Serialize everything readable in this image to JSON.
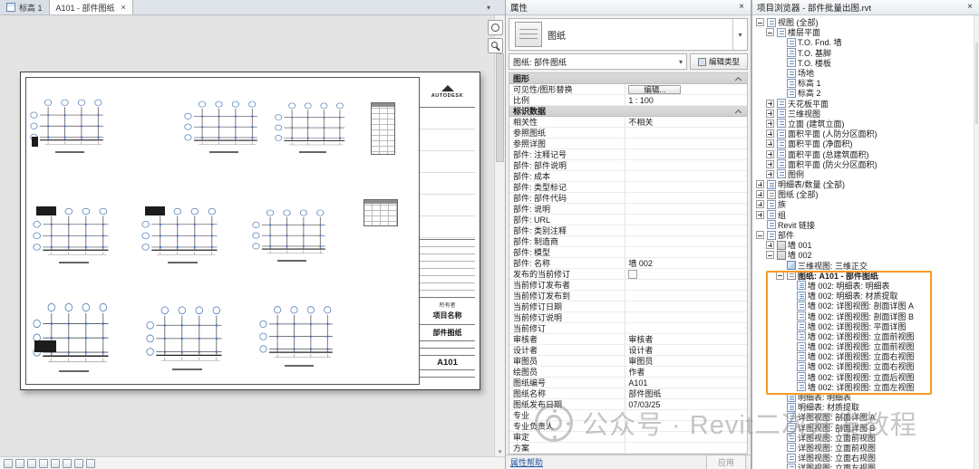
{
  "colors": {
    "highlight_orange": "#F59B22",
    "grid_bubble_blue": "#5D86C0",
    "selection_dot_blue": "#3F7BD9",
    "link_blue": "#1F55A5"
  },
  "icons": {
    "close": "×",
    "dropdown": "▾",
    "chevron_down": "▾",
    "scroll_up": "▴",
    "scroll_down": "▾"
  },
  "tabs": {
    "t1": {
      "label": "标高 1"
    },
    "t2": {
      "label": "A101 - 部件图纸"
    }
  },
  "sheet": {
    "logo": "AUTODESK",
    "owner": "所有者",
    "project": "项目名称",
    "title": "部件图纸",
    "number": "A101"
  },
  "properties": {
    "title": "属性",
    "type_label": "图纸",
    "instance_combo": "图纸: 部件图纸",
    "edit_type": "编辑类型",
    "help": "属性帮助",
    "apply": "应用",
    "rows": [
      {
        "cls": "hdr",
        "label": "图形",
        "value": ""
      },
      {
        "cls": "vbtn",
        "label": "可见性/图形替换",
        "value": "编辑..."
      },
      {
        "cls": "",
        "label": "比例",
        "value": "1 : 100"
      },
      {
        "cls": "hdr",
        "label": "标识数据",
        "value": ""
      },
      {
        "cls": "",
        "label": "相关性",
        "value": "不相关"
      },
      {
        "cls": "",
        "label": "参照图纸",
        "value": ""
      },
      {
        "cls": "",
        "label": "参照详图",
        "value": ""
      },
      {
        "cls": "",
        "label": "部件: 注释记号",
        "value": ""
      },
      {
        "cls": "",
        "label": "部件: 部件说明",
        "value": ""
      },
      {
        "cls": "",
        "label": "部件: 成本",
        "value": ""
      },
      {
        "cls": "",
        "label": "部件: 类型标记",
        "value": ""
      },
      {
        "cls": "",
        "label": "部件: 部件代码",
        "value": ""
      },
      {
        "cls": "",
        "label": "部件: 说明",
        "value": ""
      },
      {
        "cls": "",
        "label": "部件: URL",
        "value": ""
      },
      {
        "cls": "",
        "label": "部件: 类别注释",
        "value": ""
      },
      {
        "cls": "",
        "label": "部件: 制造商",
        "value": ""
      },
      {
        "cls": "",
        "label": "部件: 模型",
        "value": ""
      },
      {
        "cls": "",
        "label": "部件: 名称",
        "value": "墙 002"
      },
      {
        "cls": "vchk",
        "label": "发布的当前修订",
        "value": ""
      },
      {
        "cls": "",
        "label": "当前修订发布者",
        "value": ""
      },
      {
        "cls": "",
        "label": "当前修订发布到",
        "value": ""
      },
      {
        "cls": "",
        "label": "当前修订日期",
        "value": ""
      },
      {
        "cls": "",
        "label": "当前修订说明",
        "value": ""
      },
      {
        "cls": "",
        "label": "当前修订",
        "value": ""
      },
      {
        "cls": "",
        "label": "审核者",
        "value": "审核者"
      },
      {
        "cls": "",
        "label": "设计者",
        "value": "设计者"
      },
      {
        "cls": "",
        "label": "审图员",
        "value": "审图员"
      },
      {
        "cls": "",
        "label": "绘图员",
        "value": "作者"
      },
      {
        "cls": "",
        "label": "图纸编号",
        "value": "A101"
      },
      {
        "cls": "",
        "label": "图纸名称",
        "value": "部件图纸"
      },
      {
        "cls": "",
        "label": "图纸发布日期",
        "value": "07/03/25"
      },
      {
        "cls": "",
        "label": "专业",
        "value": ""
      },
      {
        "cls": "",
        "label": "专业负责人",
        "value": ""
      },
      {
        "cls": "",
        "label": "审定",
        "value": ""
      },
      {
        "cls": "",
        "label": "方案",
        "value": ""
      }
    ]
  },
  "browser": {
    "title": "项目浏览器 - 部件批量出图.rvt",
    "nodes_before": [
      {
        "label": "视图 (全部)",
        "cls": "lvl0 minus ic-views"
      },
      {
        "label": "楼层平面",
        "cls": "lvl1 minus ic-cat"
      },
      {
        "label": "T.O. Fnd. 墙",
        "cls": "lvl2 none ic-plan"
      },
      {
        "label": "T.O. 基脚",
        "cls": "lvl2 none ic-plan"
      },
      {
        "label": "T.O. 楼板",
        "cls": "lvl2 none ic-plan"
      },
      {
        "label": "场地",
        "cls": "lvl2 none ic-plan"
      },
      {
        "label": "标高 1",
        "cls": "lvl2 none ic-plan"
      },
      {
        "label": "标高 2",
        "cls": "lvl2 none ic-plan"
      },
      {
        "label": "天花板平面",
        "cls": "lvl1 plus ic-cat"
      },
      {
        "label": "三维视图",
        "cls": "lvl1 plus ic-cat"
      },
      {
        "label": "立面 (建筑立面)",
        "cls": "lvl1 plus ic-cat"
      },
      {
        "label": "面积平面 (人防分区面积)",
        "cls": "lvl1 plus ic-cat"
      },
      {
        "label": "面积平面 (净面积)",
        "cls": "lvl1 plus ic-cat"
      },
      {
        "label": "面积平面 (总建筑面积)",
        "cls": "lvl1 plus ic-cat"
      },
      {
        "label": "面积平面 (防火分区面积)",
        "cls": "lvl1 plus ic-cat"
      },
      {
        "label": "图例",
        "cls": "lvl1 plus ic-cat"
      },
      {
        "label": "明细表/数量 (全部)",
        "cls": "lvl0 plus ic-schedule"
      },
      {
        "label": "图纸 (全部)",
        "cls": "lvl0 plus ic-sheet"
      },
      {
        "label": "族",
        "cls": "lvl0 plus ic-family"
      },
      {
        "label": "组",
        "cls": "lvl0 plus ic-group"
      },
      {
        "label": "Revit 链接",
        "cls": "lvl0 none ic-link"
      },
      {
        "label": "部件",
        "cls": "lvl0 minus ic-assembly"
      },
      {
        "label": "墙 001",
        "cls": "lvl1 plus ic-wall"
      },
      {
        "label": "墙 002",
        "cls": "lvl1 minus ic-wall"
      },
      {
        "label": "三维视图: 三维正交",
        "cls": "lvl2 none ic-3d"
      }
    ],
    "highlight_nodes": [
      {
        "label": "图纸: A101 - 部件图纸",
        "cls": "lvl2 minus ic-sheet bold"
      },
      {
        "label": "墙 002: 明细表: 明细表",
        "cls": "lvl3 none ic-schedule"
      },
      {
        "label": "墙 002: 明细表: 材质提取",
        "cls": "lvl3 none ic-schedule"
      },
      {
        "label": "墙 002: 详图视图: 剖面详图 A",
        "cls": "lvl3 none ic-view"
      },
      {
        "label": "墙 002: 详图视图: 剖面详图 B",
        "cls": "lvl3 none ic-view"
      },
      {
        "label": "墙 002: 详图视图: 平面详图",
        "cls": "lvl3 none ic-view"
      },
      {
        "label": "墙 002: 详图视图: 立面前视图",
        "cls": "lvl3 none ic-view"
      },
      {
        "label": "墙 002: 详图视图: 立面前视图",
        "cls": "lvl3 none ic-view"
      },
      {
        "label": "墙 002: 详图视图: 立面右视图",
        "cls": "lvl3 none ic-view"
      },
      {
        "label": "墙 002: 详图视图: 立面右视图",
        "cls": "lvl3 none ic-view"
      },
      {
        "label": "墙 002: 详图视图: 立面后视图",
        "cls": "lvl3 none ic-view"
      },
      {
        "label": "墙 002: 详图视图: 立面左视图",
        "cls": "lvl3 none ic-view"
      }
    ],
    "nodes_after": [
      {
        "label": "明细表: 明细表",
        "cls": "lvl2 none ic-schedule"
      },
      {
        "label": "明细表: 材质提取",
        "cls": "lvl2 none ic-schedule"
      },
      {
        "label": "详图视图: 剖面详图 A",
        "cls": "lvl2 none ic-view"
      },
      {
        "label": "详图视图: 剖面详图 B",
        "cls": "lvl2 none ic-view"
      },
      {
        "label": "详图视图: 立面前视图",
        "cls": "lvl2 none ic-view"
      },
      {
        "label": "详图视图: 立面前视图",
        "cls": "lvl2 none ic-view"
      },
      {
        "label": "详图视图: 立面右视图",
        "cls": "lvl2 none ic-view"
      },
      {
        "label": "详图视图: 立面左视图",
        "cls": "lvl2 none ic-view"
      }
    ]
  },
  "watermark": {
    "text": "公众号 · Revit二次开发教程"
  }
}
